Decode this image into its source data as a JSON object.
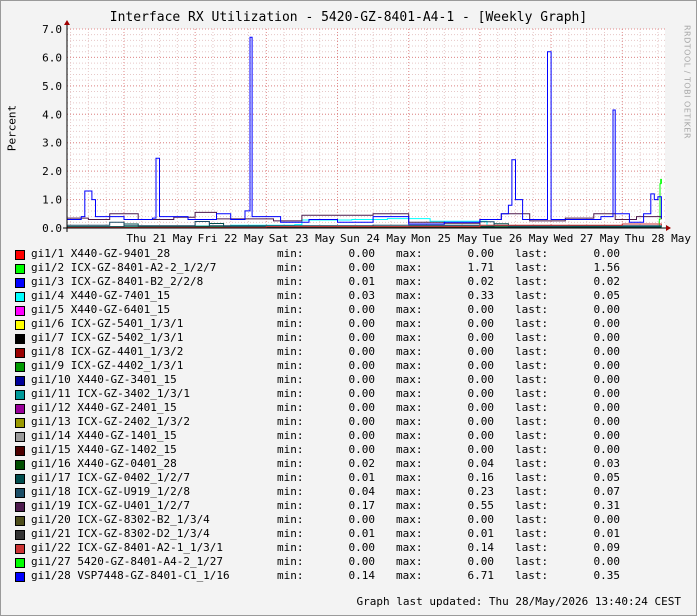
{
  "title": "Interface RX Utilization - 5420-GZ-8401-A4-1 - [Weekly Graph]",
  "side_label": "RRDTOOL / TOBI OETIKER",
  "footer": "Graph last updated: Thu 28/May/2026 13:40:24 CEST",
  "legend_labels": {
    "min": "min:",
    "max": "max:",
    "last": "last:"
  },
  "chart_data": {
    "type": "line",
    "title": "Interface RX Utilization - 5420-GZ-8401-A4-1 - [Weekly Graph]",
    "ylabel": "Percent",
    "xlabel": "",
    "ylim": [
      0,
      7
    ],
    "yticks": [
      "0.0",
      "1.0",
      "2.0",
      "3.0",
      "4.0",
      "5.0",
      "6.0",
      "7.0"
    ],
    "xticks": [
      {
        "label": "Thu 21 May",
        "x": 1.5
      },
      {
        "label": "Fri 22 May",
        "x": 2.5
      },
      {
        "label": "Sat 23 May",
        "x": 3.5
      },
      {
        "label": "Sun 24 May",
        "x": 4.5
      },
      {
        "label": "Mon 25 May",
        "x": 5.5
      },
      {
        "label": "Tue 26 May",
        "x": 6.5
      },
      {
        "label": "Wed 27 May",
        "x": 7.5
      },
      {
        "label": "Thu 28 May",
        "x": 8.5
      }
    ],
    "major_grid_x": [
      1,
      2,
      3,
      4,
      5,
      6,
      7,
      8
    ],
    "xlim": [
      0.2,
      8.6
    ],
    "grid": true,
    "series": [
      {
        "name": "gi1/1 X440-GZ-9401_28",
        "color": "#ff0000",
        "min": "0.00",
        "max": "0.00",
        "last": "0.00"
      },
      {
        "name": "gi1/2 ICX-GZ-8401-A2-2_1/2/7",
        "color": "#00ff00",
        "min": "0.00",
        "max": "1.71",
        "last": "1.56",
        "points": [
          [
            8.4,
            0.05
          ],
          [
            8.5,
            0.07
          ],
          [
            8.52,
            0.3
          ],
          [
            8.53,
            1.56
          ],
          [
            8.54,
            1.71
          ],
          [
            8.55,
            1.56
          ]
        ]
      },
      {
        "name": "gi1/3 ICX-GZ-8401-B2_2/2/8",
        "color": "#0000ff",
        "min": "0.01",
        "max": "0.02",
        "last": "0.02"
      },
      {
        "name": "gi1/4 X440-GZ-7401_15",
        "color": "#00ffff",
        "min": "0.03",
        "max": "0.33",
        "last": "0.05",
        "points": [
          [
            0.2,
            0.05
          ],
          [
            1.4,
            0.07
          ],
          [
            2.5,
            0.1
          ],
          [
            3.4,
            0.12
          ],
          [
            3.5,
            0.28
          ],
          [
            4.2,
            0.3
          ],
          [
            4.7,
            0.33
          ],
          [
            5.3,
            0.24
          ],
          [
            6.1,
            0.08
          ],
          [
            7.3,
            0.06
          ],
          [
            8.55,
            0.05
          ]
        ]
      },
      {
        "name": "gi1/5 X440-GZ-6401_15",
        "color": "#ff00ff",
        "min": "0.00",
        "max": "0.00",
        "last": "0.00"
      },
      {
        "name": "gi1/6 ICX-GZ-5401_1/3/1",
        "color": "#ffff00",
        "min": "0.00",
        "max": "0.00",
        "last": "0.00"
      },
      {
        "name": "gi1/7 ICX-GZ-5402_1/3/1",
        "color": "#000000",
        "min": "0.00",
        "max": "0.00",
        "last": "0.00"
      },
      {
        "name": "gi1/8 ICX-GZ-4401_1/3/2",
        "color": "#990000",
        "min": "0.00",
        "max": "0.00",
        "last": "0.00"
      },
      {
        "name": "gi1/9 ICX-GZ-4402_1/3/1",
        "color": "#009900",
        "min": "0.00",
        "max": "0.00",
        "last": "0.00"
      },
      {
        "name": "gi1/10 X440-GZ-3401_15",
        "color": "#000099",
        "min": "0.00",
        "max": "0.00",
        "last": "0.00"
      },
      {
        "name": "gi1/11 ICX-GZ-3402_1/3/1",
        "color": "#009999",
        "min": "0.00",
        "max": "0.00",
        "last": "0.00"
      },
      {
        "name": "gi1/12 X440-GZ-2401_15",
        "color": "#990099",
        "min": "0.00",
        "max": "0.00",
        "last": "0.00"
      },
      {
        "name": "gi1/13 ICX-GZ-2402_1/3/2",
        "color": "#999900",
        "min": "0.00",
        "max": "0.00",
        "last": "0.00"
      },
      {
        "name": "gi1/14 X440-GZ-1401_15",
        "color": "#999999",
        "min": "0.00",
        "max": "0.00",
        "last": "0.00"
      },
      {
        "name": "gi1/15 X440-GZ-1402_15",
        "color": "#4d0000",
        "min": "0.00",
        "max": "0.00",
        "last": "0.00"
      },
      {
        "name": "gi1/16 X440-GZ-0401_28",
        "color": "#004d00",
        "min": "0.02",
        "max": "0.04",
        "last": "0.03",
        "points": [
          [
            0.2,
            0.03
          ],
          [
            2.0,
            0.04
          ],
          [
            4.0,
            0.03
          ],
          [
            6.0,
            0.04
          ],
          [
            8.55,
            0.03
          ]
        ]
      },
      {
        "name": "gi1/17 ICX-GZ-0402_1/2/7",
        "color": "#004d4d",
        "min": "0.01",
        "max": "0.16",
        "last": "0.05",
        "points": [
          [
            0.2,
            0.05
          ],
          [
            1.0,
            0.14
          ],
          [
            1.2,
            0.06
          ],
          [
            2.2,
            0.16
          ],
          [
            2.4,
            0.05
          ],
          [
            5.0,
            0.06
          ],
          [
            6.2,
            0.15
          ],
          [
            6.4,
            0.05
          ],
          [
            8.55,
            0.05
          ]
        ]
      },
      {
        "name": "gi1/18 ICX-GZ-U919_1/2/8",
        "color": "#1a4d66",
        "min": "0.04",
        "max": "0.23",
        "last": "0.07",
        "points": [
          [
            0.2,
            0.1
          ],
          [
            0.8,
            0.2
          ],
          [
            1.0,
            0.08
          ],
          [
            2.0,
            0.23
          ],
          [
            2.2,
            0.08
          ],
          [
            4.5,
            0.1
          ],
          [
            6.0,
            0.22
          ],
          [
            6.2,
            0.08
          ],
          [
            8.55,
            0.07
          ]
        ]
      },
      {
        "name": "gi1/19 ICX-GZ-U401_1/2/7",
        "color": "#4d1a4d",
        "min": "0.17",
        "max": "0.55",
        "last": "0.31",
        "points": [
          [
            0.2,
            0.35
          ],
          [
            0.5,
            0.3
          ],
          [
            0.8,
            0.5
          ],
          [
            1.2,
            0.3
          ],
          [
            1.7,
            0.38
          ],
          [
            2.0,
            0.55
          ],
          [
            2.3,
            0.32
          ],
          [
            3.1,
            0.25
          ],
          [
            3.5,
            0.45
          ],
          [
            4.5,
            0.5
          ],
          [
            5.0,
            0.2
          ],
          [
            5.5,
            0.17
          ],
          [
            6.0,
            0.3
          ],
          [
            6.3,
            0.5
          ],
          [
            6.7,
            0.25
          ],
          [
            7.2,
            0.35
          ],
          [
            7.6,
            0.5
          ],
          [
            7.9,
            0.3
          ],
          [
            8.2,
            0.4
          ],
          [
            8.55,
            0.31
          ]
        ]
      },
      {
        "name": "gi1/20 ICX-GZ-8302-B2_1/3/4",
        "color": "#4d4d1a",
        "min": "0.00",
        "max": "0.00",
        "last": "0.00"
      },
      {
        "name": "gi1/21 ICX-GZ-8302-D2_1/3/4",
        "color": "#333333",
        "min": "0.01",
        "max": "0.01",
        "last": "0.01"
      },
      {
        "name": "gi1/22 ICX-GZ-8401-A2-1_1/3/1",
        "color": "#cc3333",
        "min": "0.00",
        "max": "0.14",
        "last": "0.09",
        "points": [
          [
            0.2,
            0.02
          ],
          [
            3.0,
            0.05
          ],
          [
            6.0,
            0.1
          ],
          [
            8.0,
            0.14
          ],
          [
            8.55,
            0.09
          ]
        ]
      },
      {
        "name": "gi1/27 5420-GZ-8401-A4-2_1/27",
        "color": "#00ff00",
        "min": "0.00",
        "max": "0.00",
        "last": "0.00"
      },
      {
        "name": "gi1/28 VSP7448-GZ-8401-C1_1/16",
        "color": "#0000ff",
        "min": "0.14",
        "max": "6.71",
        "last": "0.35",
        "points": [
          [
            0.2,
            0.3
          ],
          [
            0.4,
            0.4
          ],
          [
            0.45,
            1.3
          ],
          [
            0.55,
            1.0
          ],
          [
            0.6,
            0.4
          ],
          [
            1.0,
            0.3
          ],
          [
            1.4,
            0.35
          ],
          [
            1.45,
            2.45
          ],
          [
            1.5,
            0.4
          ],
          [
            1.9,
            0.3
          ],
          [
            2.3,
            0.5
          ],
          [
            2.5,
            0.3
          ],
          [
            2.7,
            0.6
          ],
          [
            2.77,
            6.71
          ],
          [
            2.8,
            0.4
          ],
          [
            3.2,
            0.2
          ],
          [
            3.6,
            0.3
          ],
          [
            4.0,
            0.2
          ],
          [
            4.5,
            0.4
          ],
          [
            5.0,
            0.14
          ],
          [
            5.5,
            0.2
          ],
          [
            6.0,
            0.3
          ],
          [
            6.3,
            0.5
          ],
          [
            6.4,
            0.8
          ],
          [
            6.45,
            2.4
          ],
          [
            6.5,
            1.0
          ],
          [
            6.6,
            0.3
          ],
          [
            6.9,
            0.3
          ],
          [
            6.95,
            6.2
          ],
          [
            7.0,
            0.3
          ],
          [
            7.3,
            0.3
          ],
          [
            7.7,
            0.4
          ],
          [
            7.87,
            4.15
          ],
          [
            7.9,
            0.5
          ],
          [
            8.1,
            0.2
          ],
          [
            8.3,
            0.5
          ],
          [
            8.4,
            1.2
          ],
          [
            8.45,
            1.0
          ],
          [
            8.5,
            1.1
          ],
          [
            8.55,
            0.35
          ]
        ]
      }
    ]
  }
}
